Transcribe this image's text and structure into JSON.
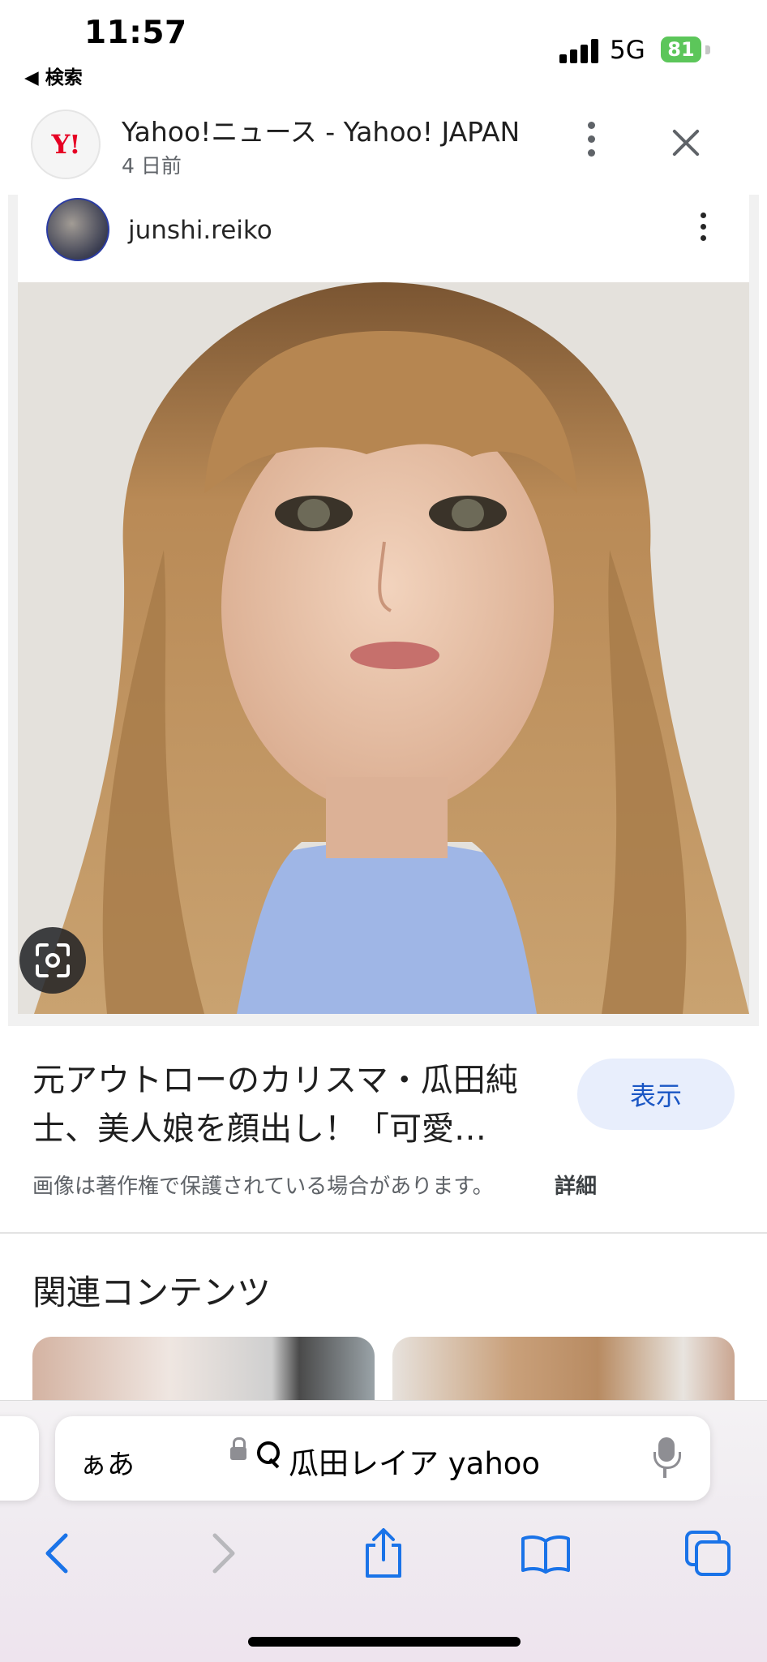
{
  "status_bar": {
    "time": "11:57",
    "back_label": "◀ 検索",
    "network": "5G",
    "battery": "81"
  },
  "header": {
    "logo_text": "Y!",
    "title": "Yahoo!ニュース - Yahoo! JAPAN",
    "subtitle": "4 日前"
  },
  "card": {
    "username": "junshi.reiko"
  },
  "result": {
    "title": "元アウトローのカリスマ・瓜田純士、美人娘を顔出し！「可愛…",
    "view_button": "表示",
    "copyright_notice": "画像は著作権で保護されている場合があります。",
    "details_link": "詳細"
  },
  "related": {
    "title": "関連コンテンツ"
  },
  "browser": {
    "aa_label": "ぁあ",
    "url_text": "瓜田レイア yahoo"
  },
  "colors": {
    "accent": "#1a56c4",
    "button_bg": "#e8eefc",
    "battery": "#5cc65a",
    "logo_red": "#e60024"
  }
}
